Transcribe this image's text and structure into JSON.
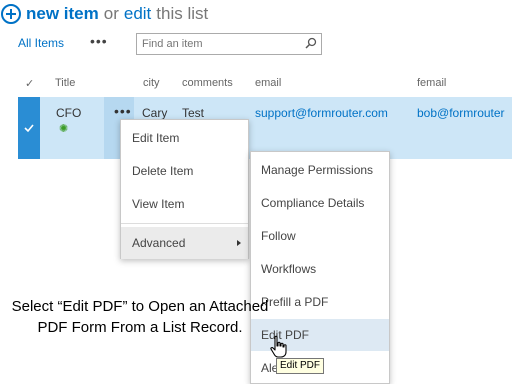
{
  "header": {
    "new_item": "new item",
    "or": "or",
    "edit": "edit",
    "this_list": "this list"
  },
  "view_bar": {
    "all_items": "All Items",
    "ellipsis": "•••",
    "search_placeholder": "Find an item"
  },
  "columns": {
    "check": "✓",
    "title": "Title",
    "city": "city",
    "comments": "comments",
    "email": "email",
    "femail": "femail"
  },
  "row": {
    "title": "CFO",
    "new_badge": "✺",
    "ellipsis": "•••",
    "city": "Cary",
    "comments": "Test",
    "email": "support@formrouter.com",
    "femail": "bob@formrouter"
  },
  "context_menu": {
    "items": [
      "Edit Item",
      "Delete Item",
      "View Item"
    ],
    "advanced": "Advanced"
  },
  "submenu": {
    "items": [
      "Manage Permissions",
      "Compliance Details",
      "Follow",
      "Workflows",
      "Prefill a PDF",
      "Edit PDF",
      "Ale"
    ]
  },
  "caption": {
    "text": "Select “Edit PDF” to Open an Attached PDF Form From a List Record."
  },
  "tooltip": {
    "text": "Edit PDF"
  },
  "colors": {
    "accent": "#0072c6",
    "row_bg": "#cde6f7",
    "check_bg": "#2a8dd4",
    "highlight": "#dde9f3"
  }
}
